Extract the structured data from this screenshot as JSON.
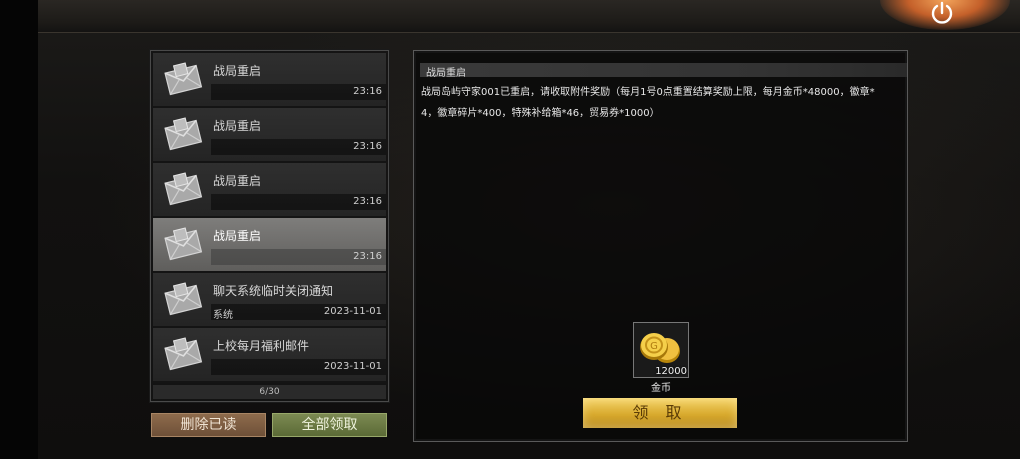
{
  "mail_list": {
    "items": [
      {
        "title": "战局重启",
        "sender": "",
        "time": "23:16",
        "selected": false
      },
      {
        "title": "战局重启",
        "sender": "",
        "time": "23:16",
        "selected": false
      },
      {
        "title": "战局重启",
        "sender": "",
        "time": "23:16",
        "selected": false
      },
      {
        "title": "战局重启",
        "sender": "",
        "time": "23:16",
        "selected": true
      },
      {
        "title": "聊天系统临时关闭通知",
        "sender": "系统",
        "time": "2023-11-01",
        "selected": false
      },
      {
        "title": "上校每月福利邮件",
        "sender": "",
        "time": "2023-11-01",
        "selected": false
      }
    ],
    "pager": "6/30"
  },
  "buttons": {
    "delete_read": "删除已读",
    "claim_all": "全部领取"
  },
  "detail": {
    "title": "战局重启",
    "body_line1": "战局岛屿守家001已重启，请收取附件奖励（每月1号0点重置结算奖励上限，每月金币*48000，徽章*",
    "body_line2": "4，徽章碎片*400，特殊补给箱*46，贸易券*1000）",
    "reward": {
      "name": "金币",
      "count": "12000",
      "icon": "gold-coin-icon"
    },
    "claim_label": "领 取"
  },
  "icons": {
    "mail": "envelope-icon",
    "power": "power-icon"
  },
  "colors": {
    "claim_gold": "#d8aa2e",
    "delete_brown": "#7e5d42",
    "claim_all_green": "#6b7a44",
    "selected_item": "#6e6d6b"
  }
}
